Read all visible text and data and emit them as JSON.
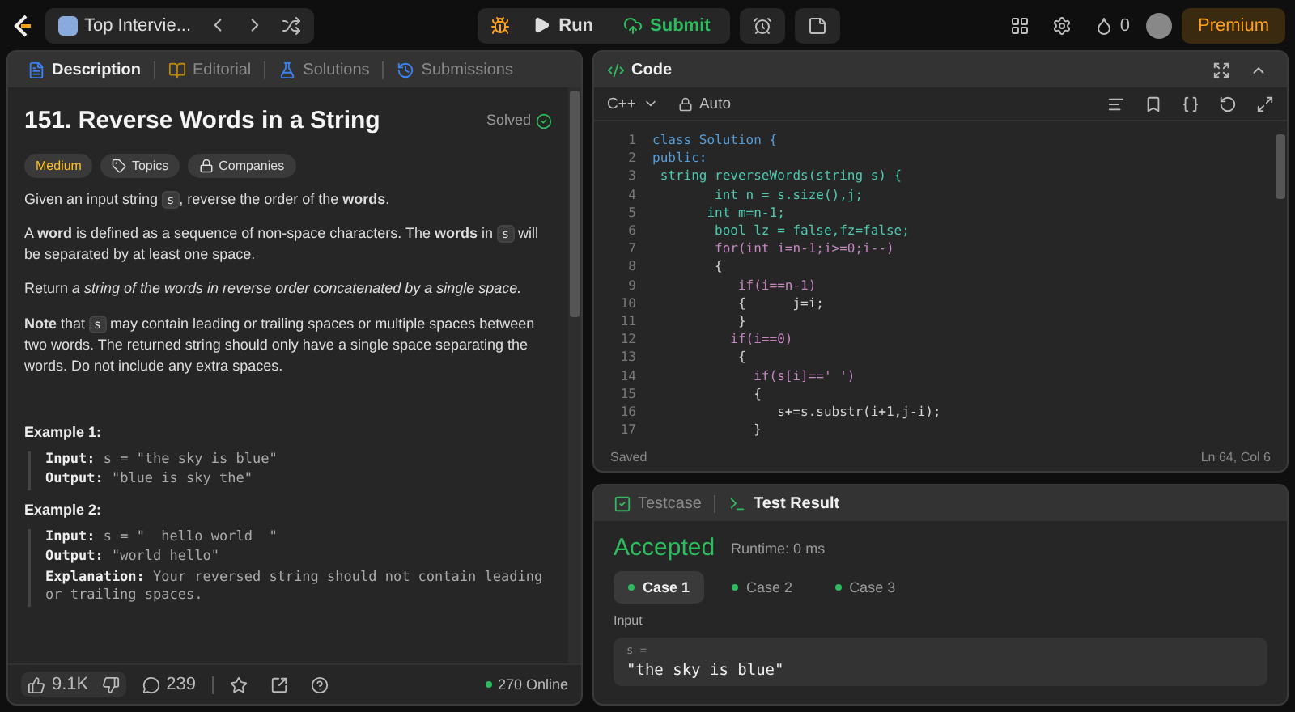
{
  "top_bar": {
    "problem_list": "Top Intervie...",
    "run": "Run",
    "submit": "Submit",
    "streak": "0",
    "premium": "Premium"
  },
  "description_panel": {
    "tabs": [
      {
        "label": "Description",
        "selected": true
      },
      {
        "label": "Editorial",
        "selected": false
      },
      {
        "label": "Solutions",
        "selected": false
      },
      {
        "label": "Submissions",
        "selected": false
      }
    ],
    "title": "151. Reverse Words in a String",
    "status": "Solved",
    "difficulty": "Medium",
    "tags": [
      "Topics",
      "Companies"
    ],
    "paragraphs": [
      [
        {
          "kind": "text",
          "text": "Given an input string "
        },
        {
          "kind": "code",
          "text": "s"
        },
        {
          "kind": "text",
          "text": ", reverse the order of the **words**."
        }
      ],
      [
        {
          "kind": "text",
          "text": "A **word** is defined as a sequence of non-space characters. The **words** in "
        },
        {
          "kind": "code",
          "text": "s"
        },
        {
          "kind": "text",
          "text": " will be separated by at least one space."
        }
      ],
      [
        {
          "kind": "text",
          "text": "Return *a string of the words in reverse order concatenated by a single space.*"
        }
      ],
      [
        {
          "kind": "text",
          "text": "**Note** that "
        },
        {
          "kind": "code",
          "text": "s"
        },
        {
          "kind": "text",
          "text": " may contain leading or trailing spaces or multiple spaces between two words. The returned string should only have a single space separating the words. Do not include any extra spaces."
        }
      ]
    ],
    "examples": [
      {
        "heading": "Example 1:",
        "lines": [
          {
            "label": "Input:",
            "value": "s = \"the sky is blue\""
          },
          {
            "label": "Output:",
            "value": "\"blue is sky the\""
          }
        ]
      },
      {
        "heading": "Example 2:",
        "lines": [
          {
            "label": "Input:",
            "value": "s = \"  hello world  \""
          },
          {
            "label": "Output:",
            "value": "\"world hello\""
          },
          {
            "label": "Explanation:",
            "value": "Your reversed string should not contain leading or trailing spaces."
          }
        ]
      }
    ],
    "footer": {
      "likes": "9.1K",
      "comments": "239",
      "online": "270 Online"
    }
  },
  "code_panel": {
    "title": "Code",
    "language": "C++",
    "mode": "Auto",
    "lines": [
      {
        "number": "1",
        "text": "class Solution {"
      },
      {
        "number": "2",
        "text": "public:"
      },
      {
        "number": "3",
        "text": " string reverseWords(string s) {"
      },
      {
        "number": "4",
        "text": "        int n = s.size(),j;"
      },
      {
        "number": "5",
        "text": "       int m=n-1;"
      },
      {
        "number": "6",
        "text": "        bool lz = false,fz=false;"
      },
      {
        "number": "7",
        "text": "        for(int i=n-1;i>=0;i--)"
      },
      {
        "number": "8",
        "text": "        {"
      },
      {
        "number": "9",
        "text": "           if(i==n-1)"
      },
      {
        "number": "10",
        "text": "           {      j=i;"
      },
      {
        "number": "11",
        "text": "           }"
      },
      {
        "number": "12",
        "text": "          if(i==0)"
      },
      {
        "number": "13",
        "text": "           {"
      },
      {
        "number": "14",
        "text": "             if(s[i]==' ')"
      },
      {
        "number": "15",
        "text": "             {"
      },
      {
        "number": "16",
        "text": "                s+=s.substr(i+1,j-i);"
      },
      {
        "number": "17",
        "text": "             }"
      }
    ],
    "status": "Saved",
    "cursor": "Ln 64, Col 6"
  },
  "result_panel": {
    "tabs": [
      {
        "label": "Testcase",
        "selected": false
      },
      {
        "label": "Test Result",
        "selected": true
      }
    ],
    "verdict": "Accepted",
    "runtime": "Runtime: 0 ms",
    "cases": [
      {
        "label": "Case 1",
        "selected": true
      },
      {
        "label": "Case 2",
        "selected": false
      },
      {
        "label": "Case 3",
        "selected": false
      }
    ],
    "input_label": "Input",
    "variable": "s =",
    "value": "\"the sky is blue\""
  }
}
